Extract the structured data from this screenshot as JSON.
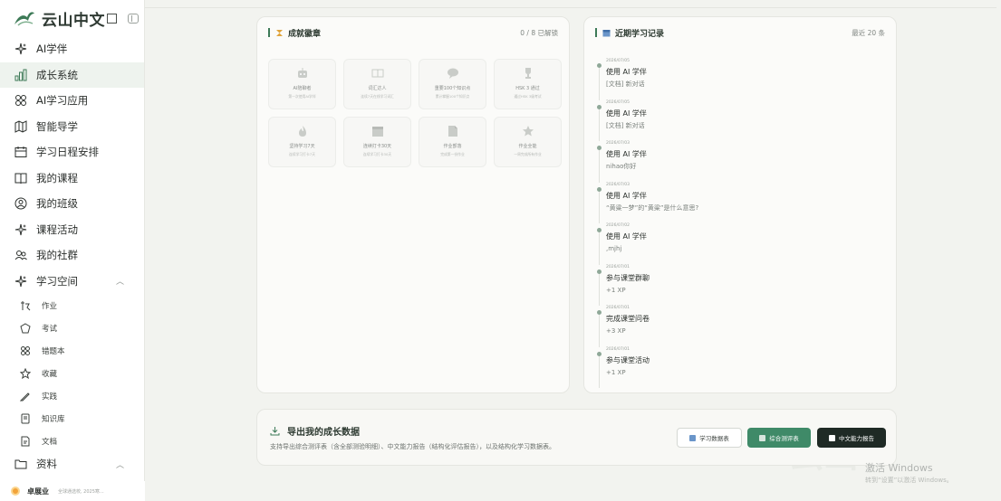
{
  "app": {
    "brand": "云山中文",
    "brand_color": "#3d7a57"
  },
  "sidebar": {
    "items": [
      {
        "label": "AI学伴",
        "icon": "sparkle-icon",
        "active": false
      },
      {
        "label": "成长系统",
        "icon": "bar-chart-icon",
        "active": true
      },
      {
        "label": "AI学习应用",
        "icon": "grid-icon",
        "active": false
      },
      {
        "label": "智能导学",
        "icon": "map-icon",
        "active": false
      },
      {
        "label": "学习日程安排",
        "icon": "calendar-icon",
        "active": false
      },
      {
        "label": "我的课程",
        "icon": "book-icon",
        "active": false
      },
      {
        "label": "我的班级",
        "icon": "user-circle-icon",
        "active": false
      },
      {
        "label": "课程活动",
        "icon": "sparkle-icon",
        "active": false
      },
      {
        "label": "我的社群",
        "icon": "users-icon",
        "active": false
      },
      {
        "label": "学习空间",
        "icon": "sparkle-icon",
        "active": false,
        "expanded": true
      }
    ],
    "sub_items": [
      {
        "label": "作业",
        "icon": "pen-icon"
      },
      {
        "label": "考试",
        "icon": "shield-icon"
      },
      {
        "label": "错题本",
        "icon": "grid-icon"
      },
      {
        "label": "收藏",
        "icon": "star-icon"
      },
      {
        "label": "实践",
        "icon": "pencil-icon"
      },
      {
        "label": "知识库",
        "icon": "book-open-icon"
      },
      {
        "label": "文档",
        "icon": "file-icon"
      }
    ],
    "more": {
      "label": "资料",
      "icon": "folder-icon"
    },
    "user": {
      "name": "卓展业",
      "subtitle": "全球通选校, 2025寒..."
    }
  },
  "achievements": {
    "title": "成就徽章",
    "meta": "0 / 8 已解锁",
    "badges": [
      {
        "name": "AI陪聊者",
        "desc": "第一次使用AI学伴",
        "icon": "robot-icon"
      },
      {
        "name": "词汇达人",
        "desc": "连续7天在线学习词汇",
        "icon": "book-icon"
      },
      {
        "name": "重要100个知识点",
        "desc": "累计掌握100个知识点",
        "icon": "chat-icon"
      },
      {
        "name": "HSK 3 通过",
        "desc": "通过HSK 3级考试",
        "icon": "trophy-icon"
      },
      {
        "name": "坚持学习7天",
        "desc": "连续学习打卡7天",
        "icon": "flame-icon"
      },
      {
        "name": "连续打卡30天",
        "desc": "连续学习打卡30天",
        "icon": "calendar-icon"
      },
      {
        "name": "作业部落",
        "desc": "完成第一份作业",
        "icon": "note-icon"
      },
      {
        "name": "作业全能",
        "desc": "一周完成所有作业",
        "icon": "star-icon"
      }
    ]
  },
  "records": {
    "title": "近期学习记录",
    "meta": "最近 20 条",
    "items": [
      {
        "date": "2026/07/05",
        "title": "使用 AI 学伴",
        "detail": "[文档] 新对话"
      },
      {
        "date": "2026/07/05",
        "title": "使用 AI 学伴",
        "detail": "[文档] 新对话"
      },
      {
        "date": "2026/07/03",
        "title": "使用 AI 学伴",
        "detail": "nihao你好"
      },
      {
        "date": "2026/07/03",
        "title": "使用 AI 学伴",
        "detail": "“黄粱一梦”的“黄粱”是什么意思?"
      },
      {
        "date": "2026/07/02",
        "title": "使用 AI 学伴",
        "detail": ",mjhj"
      },
      {
        "date": "2026/07/01",
        "title": "参与课堂群聊",
        "detail": "+1 XP"
      },
      {
        "date": "2026/07/01",
        "title": "完成课堂问卷",
        "detail": "+3 XP"
      },
      {
        "date": "2026/07/01",
        "title": "参与课堂活动",
        "detail": "+1 XP"
      }
    ]
  },
  "export": {
    "title": "导出我的成长数据",
    "desc": "支持导出综合测评表（含全部测验明细）、中文能力报告（结构化评估报告），以及结构化学习数据表。",
    "buttons": {
      "data_table": "学习数据表",
      "assessment": "综合测评表",
      "report": "中文能力报告"
    }
  },
  "watermark": {
    "line1": "激活 Windows",
    "line2": "转到“设置”以激活 Windows。"
  }
}
